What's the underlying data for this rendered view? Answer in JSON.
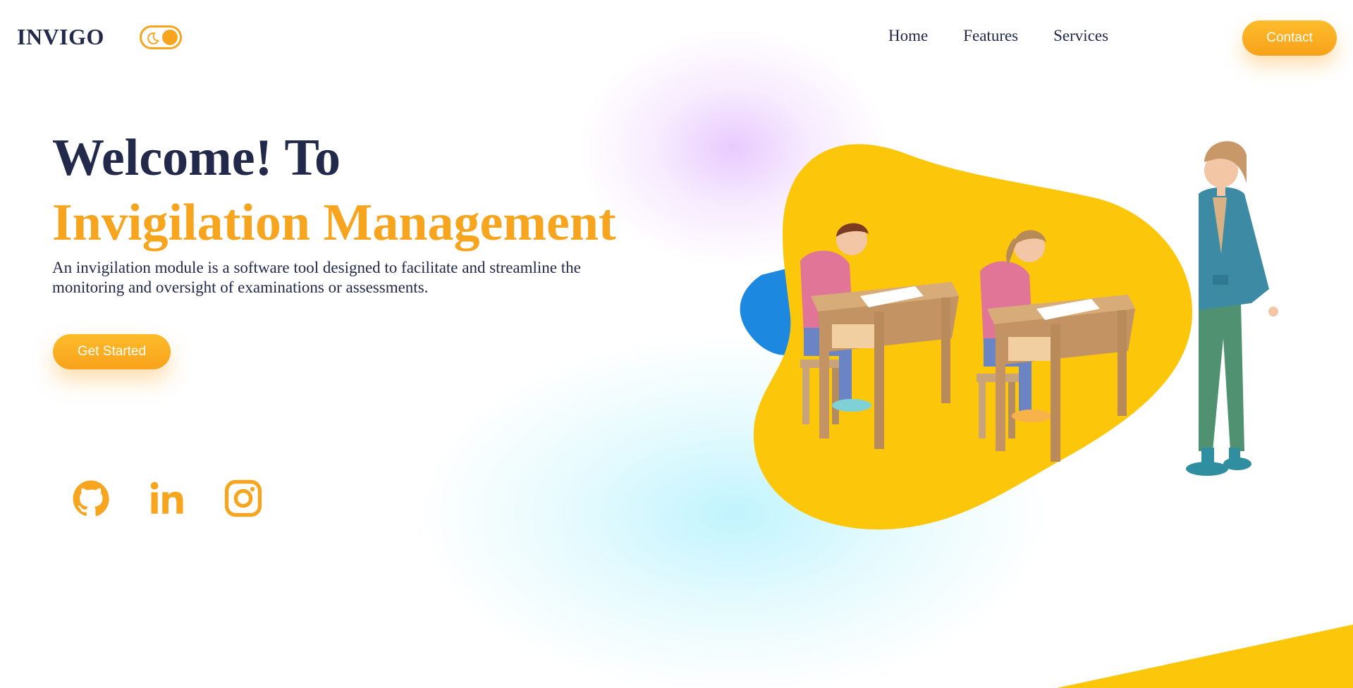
{
  "header": {
    "brand": "INVIGO",
    "nav": [
      {
        "label": "Home"
      },
      {
        "label": "Features"
      },
      {
        "label": "Services"
      }
    ],
    "contact_label": "Contact",
    "theme_toggle_icon": "moon-icon"
  },
  "hero": {
    "title_line1": "Welcome! To",
    "title_line2": "Invigilation Management",
    "description": "An invigilation module is a software tool designed to facilitate and streamline the monitoring and oversight of examinations or assessments.",
    "cta_label": "Get Started"
  },
  "social": [
    {
      "icon": "github-icon"
    },
    {
      "icon": "linkedin-icon"
    },
    {
      "icon": "instagram-icon"
    }
  ],
  "colors": {
    "accent": "#f7a51f",
    "text_dark": "#23294a",
    "blob_yellow": "#fcc70a",
    "blob_blue": "#1d88e0"
  }
}
